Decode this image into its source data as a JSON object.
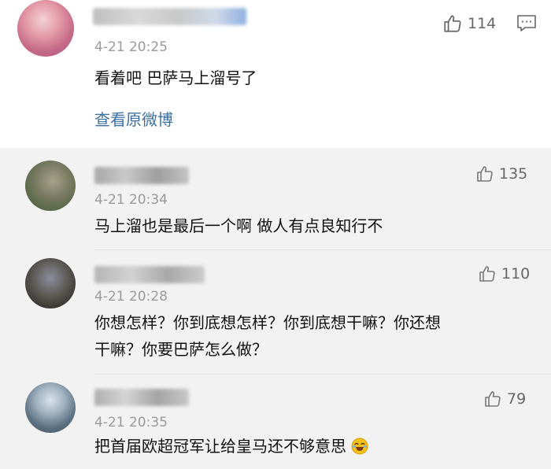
{
  "main_comment": {
    "time": "4-21 20:25",
    "likes": "114",
    "text": "看着吧 巴萨马上溜号了",
    "view_original_label": "查看原微博"
  },
  "replies": [
    {
      "time": "4-21 20:34",
      "likes": "135",
      "text_lines": [
        "马上溜也是最后一个啊 做人有点良知行不"
      ]
    },
    {
      "time": "4-21 20:28",
      "likes": "110",
      "text_lines": [
        "你想怎样？你到底想怎样？你到底想干嘛？你还想",
        "干嘛？你要巴萨怎么做？"
      ]
    },
    {
      "time": "4-21 20:35",
      "likes": "79",
      "text_lines": [
        "把首届欧超冠军让给皇马还不够意思"
      ],
      "emoji": "laughing-crying-emoji"
    }
  ],
  "colors": {
    "link": "#3b6fa3",
    "reply_bg": "#f2f2f2",
    "meta_text": "#9a9a9a"
  },
  "icons": [
    "thumbs-up-icon",
    "comment-icon",
    "laughing-crying-emoji"
  ]
}
